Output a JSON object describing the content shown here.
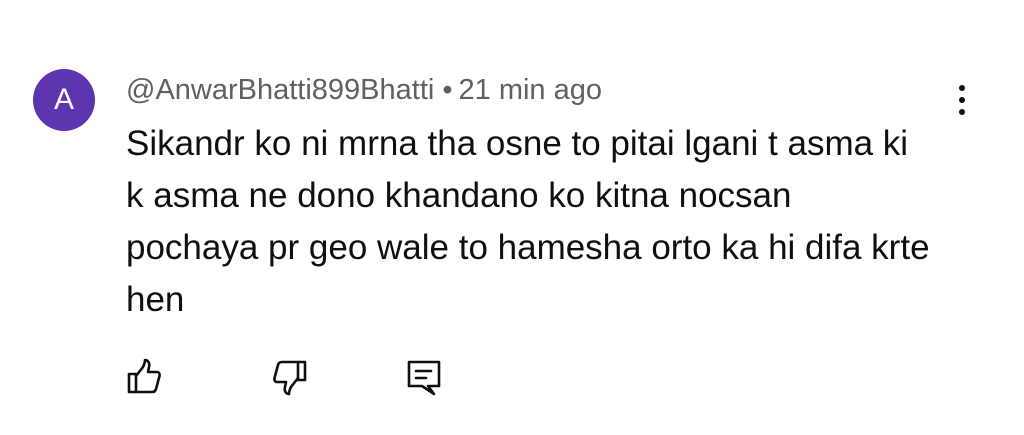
{
  "comment": {
    "avatar_letter": "A",
    "avatar_color": "#5e35b1",
    "author": "@AnwarBhatti899Bhatti",
    "separator": "•",
    "timestamp": "21 min ago",
    "text": "Sikandr ko ni mrna tha osne to pitai lgani t asma ki\nk asma ne dono  khandano ko kitna nocsan\npochaya pr geo wale to hamesha orto ka hi difa krte\nhen"
  },
  "actions": {
    "like_icon": "thumbs-up-icon",
    "dislike_icon": "thumbs-down-icon",
    "reply_icon": "comment-reply-icon",
    "menu_icon": "more-vert-icon"
  }
}
